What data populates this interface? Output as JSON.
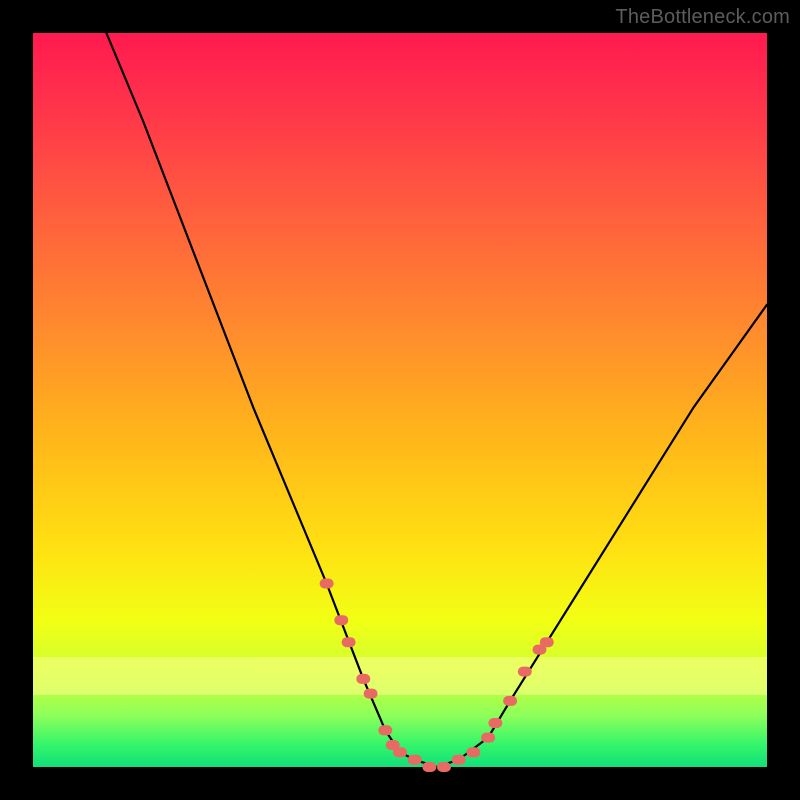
{
  "watermark": "TheBottleneck.com",
  "colors": {
    "frame_bg": "#000000",
    "gradient_top": "#ff1a4f",
    "gradient_bottom": "#11e07a",
    "curve": "#000000",
    "markers": "#e86a63",
    "watermark": "#5c5c5c"
  },
  "chart_data": {
    "type": "line",
    "title": "",
    "xlabel": "",
    "ylabel": "",
    "xlim": [
      0,
      100
    ],
    "ylim": [
      0,
      100
    ],
    "x": [
      10,
      15,
      20,
      25,
      30,
      35,
      40,
      45,
      48,
      50,
      52,
      55,
      58,
      62,
      65,
      70,
      75,
      80,
      85,
      90,
      95,
      100
    ],
    "values": [
      100,
      88,
      75,
      62,
      49,
      37,
      25,
      12,
      5,
      2,
      1,
      0,
      1,
      4,
      9,
      17,
      25,
      33,
      41,
      49,
      56,
      63
    ],
    "marker_points": [
      {
        "x": 40,
        "y": 25
      },
      {
        "x": 42,
        "y": 20
      },
      {
        "x": 43,
        "y": 17
      },
      {
        "x": 45,
        "y": 12
      },
      {
        "x": 46,
        "y": 10
      },
      {
        "x": 48,
        "y": 5
      },
      {
        "x": 49,
        "y": 3
      },
      {
        "x": 50,
        "y": 2
      },
      {
        "x": 52,
        "y": 1
      },
      {
        "x": 54,
        "y": 0
      },
      {
        "x": 56,
        "y": 0
      },
      {
        "x": 58,
        "y": 1
      },
      {
        "x": 60,
        "y": 2
      },
      {
        "x": 62,
        "y": 4
      },
      {
        "x": 63,
        "y": 6
      },
      {
        "x": 65,
        "y": 9
      },
      {
        "x": 67,
        "y": 13
      },
      {
        "x": 69,
        "y": 16
      },
      {
        "x": 70,
        "y": 17
      }
    ]
  }
}
